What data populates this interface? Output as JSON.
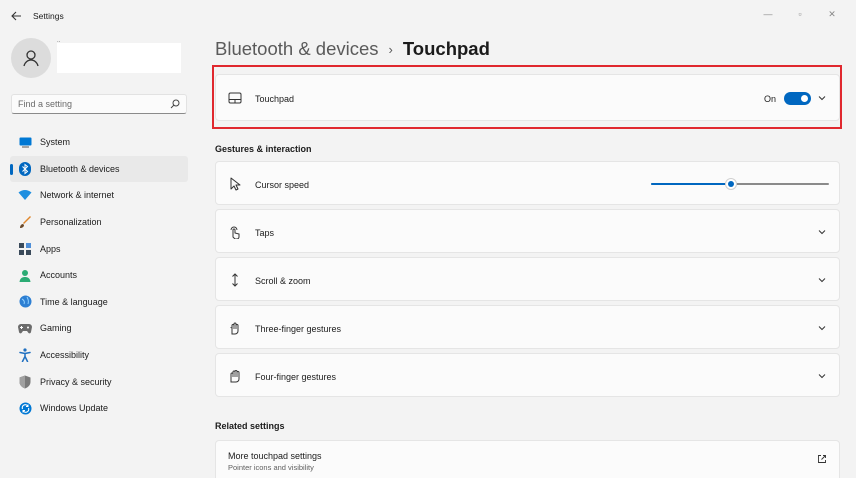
{
  "window": {
    "title": "Settings",
    "minimize": "—",
    "maximize": "▫",
    "close": "✕"
  },
  "sidebar": {
    "user_initial": "..",
    "search_placeholder": "Find a setting",
    "items": [
      {
        "label": "System",
        "icon": "system-icon",
        "color": "#0078d4"
      },
      {
        "label": "Bluetooth & devices",
        "icon": "bluetooth-icon",
        "color": "#0067c0",
        "active": true
      },
      {
        "label": "Network & internet",
        "icon": "wifi-icon",
        "color": "#1f8fe0"
      },
      {
        "label": "Personalization",
        "icon": "brush-icon",
        "color": "#e0862b"
      },
      {
        "label": "Apps",
        "icon": "apps-icon",
        "color": "#3a4a5a"
      },
      {
        "label": "Accounts",
        "icon": "accounts-icon",
        "color": "#2bab74"
      },
      {
        "label": "Time & language",
        "icon": "globe-icon",
        "color": "#2d7fd3"
      },
      {
        "label": "Gaming",
        "icon": "gaming-icon",
        "color": "#6b6b6b"
      },
      {
        "label": "Accessibility",
        "icon": "accessibility-icon",
        "color": "#1f6fc0"
      },
      {
        "label": "Privacy & security",
        "icon": "shield-icon",
        "color": "#7a7a7a"
      },
      {
        "label": "Windows Update",
        "icon": "update-icon",
        "color": "#0078d4"
      }
    ]
  },
  "breadcrumb": {
    "parent": "Bluetooth & devices",
    "separator": "›",
    "current": "Touchpad"
  },
  "touchpad_card": {
    "label": "Touchpad",
    "toggle_text": "On",
    "toggle_on": true
  },
  "gestures": {
    "title": "Gestures & interaction",
    "cursor_speed": {
      "label": "Cursor speed",
      "value_fraction": 0.45
    },
    "items": [
      {
        "label": "Taps",
        "icon": "tap-icon"
      },
      {
        "label": "Scroll & zoom",
        "icon": "scroll-icon"
      },
      {
        "label": "Three-finger gestures",
        "icon": "three-finger-icon"
      },
      {
        "label": "Four-finger gestures",
        "icon": "four-finger-icon"
      }
    ]
  },
  "related": {
    "title": "Related settings",
    "more_label": "More touchpad settings",
    "more_sub": "Pointer icons and visibility"
  }
}
